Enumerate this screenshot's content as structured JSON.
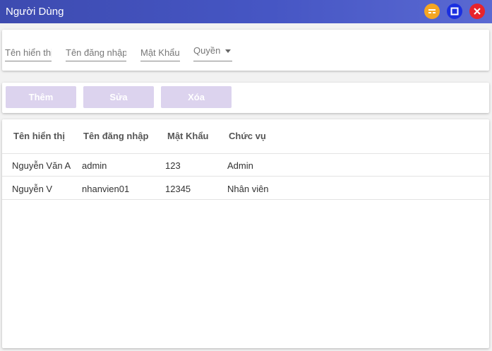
{
  "window": {
    "title": "Người Dùng",
    "controls": {
      "minimize": "minimize-icon",
      "maximize": "maximize-icon",
      "close": "close-icon"
    },
    "colors": {
      "minimize": "#f5a623",
      "maximize": "#1a2fe0",
      "close": "#e8242b",
      "titlebar": "#4352bd"
    }
  },
  "filters": {
    "display_name_placeholder": "Tên hiển thị",
    "username_placeholder": "Tên đăng nhập",
    "password_placeholder": "Mật Khẩu",
    "role_label": "Quyền"
  },
  "actions": {
    "add_label": "Thêm",
    "edit_label": "Sửa",
    "delete_label": "Xóa",
    "button_color": "#dcd3ee"
  },
  "table": {
    "headers": [
      "Tên hiển thị",
      "Tên đăng nhập",
      "Mật Khẩu",
      "Chức vụ"
    ],
    "rows": [
      [
        "Nguyễn Văn A",
        "admin",
        "123",
        "Admin"
      ],
      [
        "Nguyễn V",
        "nhanvien01",
        "12345",
        "Nhân viên"
      ]
    ]
  }
}
